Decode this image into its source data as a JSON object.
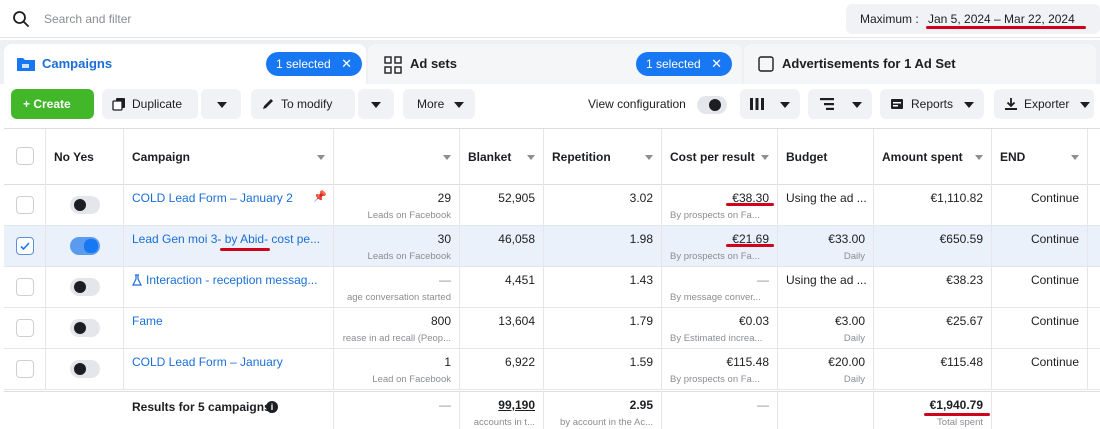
{
  "search": {
    "placeholder": "Search and filter"
  },
  "date_range": {
    "label": "Maximum :",
    "value": "Jan 5, 2024 – Mar 22, 2024"
  },
  "tabs": [
    {
      "label": "Campaigns",
      "selected_badge": "1 selected"
    },
    {
      "label": "Ad sets",
      "selected_badge": "1 selected"
    },
    {
      "label": "Advertisements for 1 Ad Set"
    }
  ],
  "toolbar": {
    "create": "+ Create",
    "duplicate": "Duplicate",
    "modify": "To modify",
    "more": "More",
    "view_configuration": "View configuration",
    "reports": "Reports",
    "exporter": "Exporter"
  },
  "columns": [
    "No Yes",
    "Campaign",
    "",
    "Blanket",
    "Repetition",
    "Cost per result",
    "Budget",
    "Amount spent",
    "END"
  ],
  "rows": [
    {
      "checked": false,
      "on": false,
      "campaign": "COLD Lead Form – January 2",
      "pinned": true,
      "results": "29",
      "results_sub": "Leads on Facebook",
      "blanket": "52,905",
      "repetition": "3.02",
      "cost": "€38.30",
      "cost_sub": "By prospects on Fa...",
      "budget": "Using the ad ...",
      "budget_sub": "",
      "spent": "€1,110.82",
      "end": "Continue"
    },
    {
      "checked": true,
      "on": true,
      "campaign": "Lead Gen moi 3- by Abid- cost pe...",
      "pinned": false,
      "results": "30",
      "results_sub": "Leads on Facebook",
      "blanket": "46,058",
      "repetition": "1.98",
      "cost": "€21.69",
      "cost_sub": "By prospects on Fa...",
      "budget": "€33.00",
      "budget_sub": "Daily",
      "spent": "€650.59",
      "end": "Continue"
    },
    {
      "checked": false,
      "on": false,
      "campaign": "Interaction - reception messag...",
      "pinned": false,
      "flask": true,
      "results": "—",
      "results_sub": "age conversation started",
      "blanket": "4,451",
      "repetition": "1.43",
      "cost": "—",
      "cost_sub": "By message conver...",
      "budget": "Using the ad ...",
      "budget_sub": "",
      "spent": "€38.23",
      "end": "Continue"
    },
    {
      "checked": false,
      "on": false,
      "campaign": "Fame",
      "pinned": false,
      "results": "800",
      "results_sub": "rease in ad recall (Peop...",
      "blanket": "13,604",
      "repetition": "1.79",
      "cost": "€0.03",
      "cost_sub": "By Estimated increa...",
      "budget": "€3.00",
      "budget_sub": "Daily",
      "spent": "€25.67",
      "end": "Continue"
    },
    {
      "checked": false,
      "on": false,
      "campaign": "COLD Lead Form – January",
      "pinned": false,
      "results": "1",
      "results_sub": "Lead on Facebook",
      "blanket": "6,922",
      "repetition": "1.59",
      "cost": "€115.48",
      "cost_sub": "By prospects on Fa...",
      "budget": "€20.00",
      "budget_sub": "Daily",
      "spent": "€115.48",
      "end": "Continue"
    }
  ],
  "totals": {
    "label": "Results for 5 campaigns",
    "results": "—",
    "blanket": "99,190",
    "blanket_sub": "accounts in t...",
    "repetition": "2.95",
    "repetition_sub": "by account in the Ac...",
    "cost": "—",
    "spent": "€1,940.79",
    "spent_sub": "Total spent"
  },
  "colors": {
    "accent": "#1877f2",
    "create": "#42b72a",
    "annotation": "#d0021b"
  }
}
